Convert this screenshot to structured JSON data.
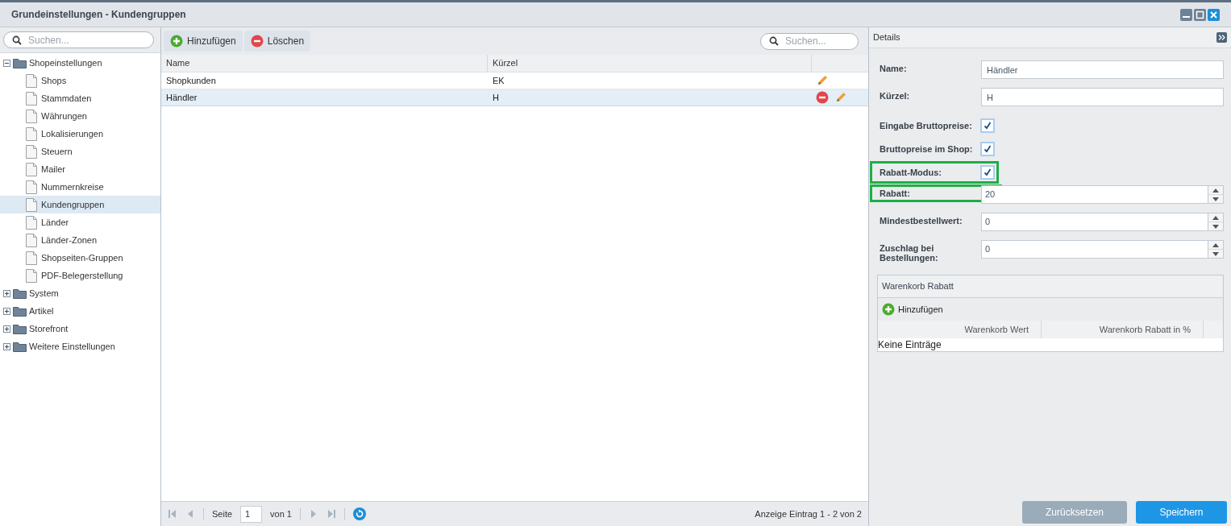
{
  "window": {
    "title": "Grundeinstellungen - Kundengruppen"
  },
  "sidebar": {
    "search": {
      "placeholder": "Suchen..."
    },
    "tree": [
      {
        "label": "Shopeinstellungen",
        "expanded": true,
        "selected": false,
        "children": [
          {
            "label": "Shops",
            "selected": false
          },
          {
            "label": "Stammdaten",
            "selected": false
          },
          {
            "label": "Währungen",
            "selected": false
          },
          {
            "label": "Lokalisierungen",
            "selected": false
          },
          {
            "label": "Steuern",
            "selected": false
          },
          {
            "label": "Mailer",
            "selected": false
          },
          {
            "label": "Nummernkreise",
            "selected": false
          },
          {
            "label": "Kundengruppen",
            "selected": true
          },
          {
            "label": "Länder",
            "selected": false
          },
          {
            "label": "Länder-Zonen",
            "selected": false
          },
          {
            "label": "Shopseiten-Gruppen",
            "selected": false
          },
          {
            "label": "PDF-Belegerstellung",
            "selected": false
          }
        ]
      },
      {
        "label": "System",
        "expanded": false,
        "selected": false
      },
      {
        "label": "Artikel",
        "expanded": false,
        "selected": false
      },
      {
        "label": "Storefront",
        "expanded": false,
        "selected": false
      },
      {
        "label": "Weitere Einstellungen",
        "expanded": false,
        "selected": false
      }
    ]
  },
  "grid": {
    "toolbar": {
      "add": "Hinzufügen",
      "delete": "Löschen",
      "search": {
        "placeholder": "Suchen..."
      }
    },
    "columns": [
      "Name",
      "Kürzel"
    ],
    "rows": [
      {
        "name": "Shopkunden",
        "short": "EK",
        "selected": false
      },
      {
        "name": "Händler",
        "short": "H",
        "selected": true
      }
    ],
    "paging": {
      "page_label": "Seite",
      "page": "1",
      "of": "von 1",
      "summary": "Anzeige Eintrag 1 - 2 von 2"
    }
  },
  "details": {
    "title": "Details",
    "fields": [
      {
        "kind": "text",
        "label": "Name:",
        "value": "Händler",
        "highlighted": false
      },
      {
        "kind": "text",
        "label": "Kürzel:",
        "value": "H",
        "highlighted": false
      },
      {
        "kind": "checkbox",
        "label": "Eingabe Bruttopreise:",
        "checked": true,
        "highlighted": false
      },
      {
        "kind": "checkbox",
        "label": "Bruttopreise im Shop:",
        "checked": true,
        "highlighted": false
      },
      {
        "kind": "checkbox",
        "label": "Rabatt-Modus:",
        "checked": true,
        "highlighted": true
      },
      {
        "kind": "number",
        "label": "Rabatt:",
        "value": "20",
        "highlighted": true
      },
      {
        "kind": "number",
        "label": "Mindestbestellwert:",
        "value": "0",
        "highlighted": false
      },
      {
        "kind": "number",
        "label": "Zuschlag bei Bestellungen:",
        "value": "0",
        "highlighted": false
      }
    ],
    "cart_discount": {
      "title": "Warenkorb Rabatt",
      "add": "Hinzufügen",
      "columns": [
        "Warenkorb Wert",
        "Warenkorb Rabatt in %"
      ],
      "empty": "Keine Einträge"
    },
    "buttons": {
      "reset": "Zurücksetzen",
      "save": "Speichern"
    }
  }
}
